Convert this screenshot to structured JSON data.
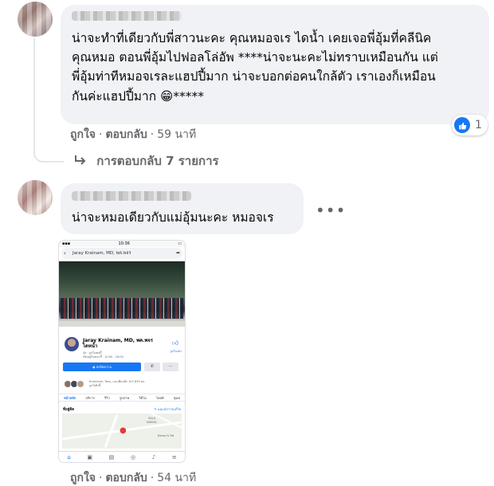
{
  "comment1": {
    "text_lines": [
      "น่าจะทำที่เดียวกับพี่สาวนะคะ คุณหมอจเร ไดน้ำ เคยเจอพี่อุ้มที่คลีนิค",
      "คุณหมอ ตอนพี่อุ้มไปฟอลโล่อัพ ****น่าจะนะคะไม่ทราบเหมือนกัน แต่",
      "พี่อุ้มท่าทีหมอจเรละแฮปปี้มาก น่าจะบอกต่อคนใกล้ตัว เราเองก็เหมือน",
      "กันค่ะแฮปปี้มาก 😁*****"
    ],
    "like_label": "ถูกใจ",
    "reply_label": "ตอบกลับ",
    "time": "59 นาที",
    "reaction_count": "1"
  },
  "replies": {
    "label": "การตอบกลับ 7 รายการ",
    "icon": "reply-arrow-icon"
  },
  "comment2": {
    "text": "น่าจะหมอเดียวกับแม่อุ้มนะคะ หมอจเร",
    "more": "•••",
    "like_label": "ถูกใจ",
    "reply_label": "ตอบกลับ",
    "time": "54 นาที"
  },
  "phone": {
    "status_time": "10:36",
    "search_text": "Jaray Krainam, MD, พค.พจร",
    "page_name": "Jaray Krainam, MD, พค.พจร",
    "page_name_line2": "ไดหน้ำ",
    "sub_line1": "4k · ถูกใจเพจนี้",
    "sub_line2": "เปิดอยู่ในขณะนี้ · 10:00 - 18:00",
    "like_text": "ถูกใจแล้ว",
    "action_button": "ส่งข้อความ",
    "friends_text": "Krainiram, Tony, และเพื่อนอีก 107,839 คน ถูกใจสิ่งนี้",
    "tabs": [
      "หน้าหลัก",
      "บริการ",
      "รีวิว",
      "รูปภาพ",
      "วิดีโอ",
      "โพสต์",
      "ชุมช"
    ],
    "section_title": "ที่อยู่ติด",
    "section_link": "แนะนำการแก้ไข",
    "map_label_1": "SALA",
    "map_label_2": "DAENG",
    "map_label_3": "Rama IV Rd"
  },
  "colors": {
    "bubble": "#f0f2f5",
    "meta": "#65676b",
    "fb_blue": "#1877f2"
  }
}
